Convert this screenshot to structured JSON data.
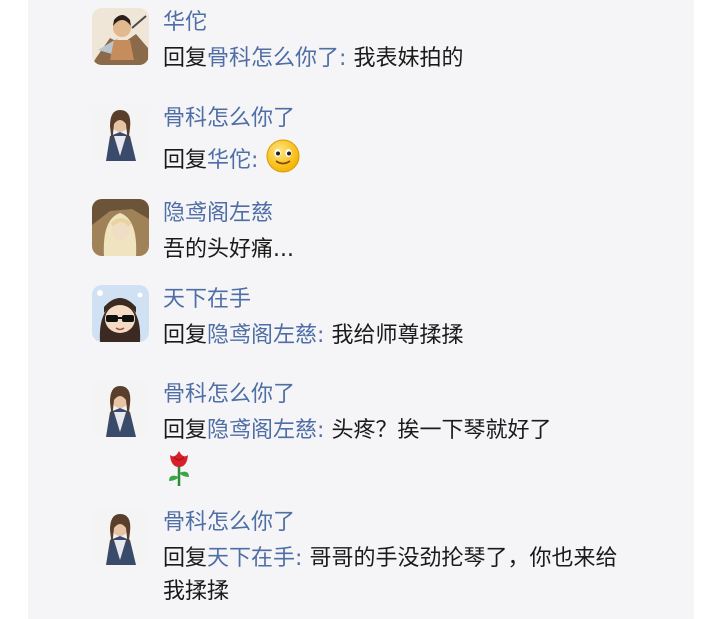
{
  "comments": [
    {
      "author": "华佗",
      "reply_prefix": "回复",
      "reply_to": "骨科怎么你了",
      "colon": ":",
      "text": " 我表妹拍的",
      "avatar_icon": "warrior-avatar-icon"
    },
    {
      "author": "骨科怎么你了",
      "reply_prefix": "回复",
      "reply_to": "华佗",
      "colon": ":",
      "text": " ",
      "emoji": "smile-emoji-icon",
      "avatar_icon": "robed-man-avatar-icon"
    },
    {
      "author": "隐鸢阁左慈",
      "text": "吾的头好痛...",
      "avatar_icon": "blonde-sage-avatar-icon"
    },
    {
      "author": "天下在手",
      "reply_prefix": "回复",
      "reply_to": "隐鸢阁左慈",
      "colon": ":",
      "text": " 我给师尊揉揉",
      "avatar_icon": "sunglasses-cartoon-avatar-icon"
    },
    {
      "author": "骨科怎么你了",
      "reply_prefix": "回复",
      "reply_to": "隐鸢阁左慈",
      "colon": ":",
      "text": " 头疼？挨一下琴就好了",
      "emoji": "rose-emoji-icon",
      "avatar_icon": "robed-man-avatar-icon"
    },
    {
      "author": "骨科怎么你了",
      "reply_prefix": "回复",
      "reply_to": "天下在手",
      "colon": ":",
      "text": " 哥哥的手没劲抡琴了，你也来给我揉揉",
      "avatar_icon": "robed-man-avatar-icon"
    }
  ],
  "colors": {
    "name": "#4f6ea5",
    "text": "#1a1a1a",
    "panel_bg": "#f5f5f7"
  }
}
